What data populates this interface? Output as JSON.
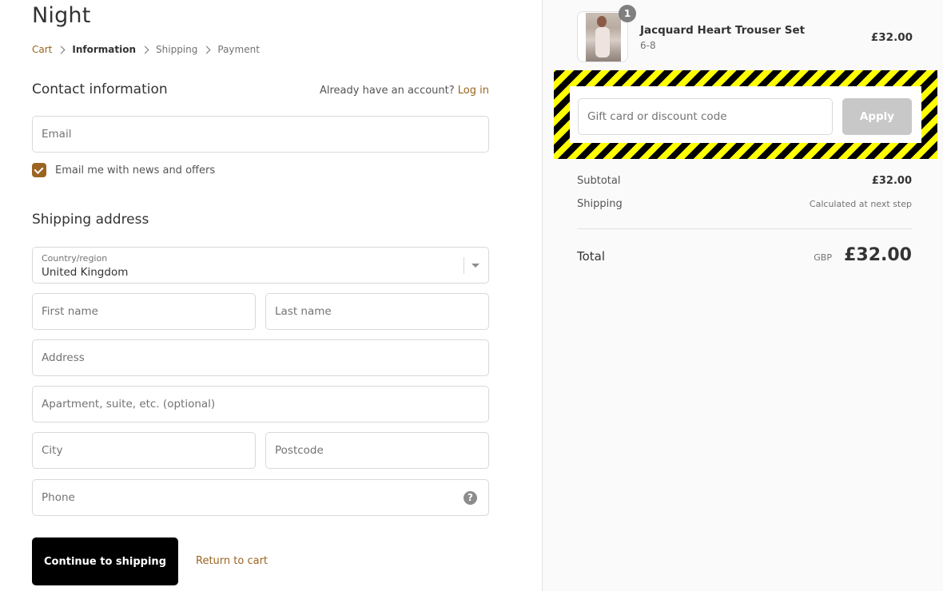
{
  "shop": {
    "title": "Night"
  },
  "breadcrumb": [
    {
      "label": "Cart",
      "state": "link"
    },
    {
      "label": "Information",
      "state": "current"
    },
    {
      "label": "Shipping",
      "state": "upcoming"
    },
    {
      "label": "Payment",
      "state": "upcoming"
    }
  ],
  "contact": {
    "title": "Contact information",
    "login_prompt": "Already have an account?",
    "login_link": "Log in",
    "email_placeholder": "Email",
    "email_value": "",
    "newsletter_label": "Email me with news and offers",
    "newsletter_checked": true
  },
  "shipping": {
    "title": "Shipping address",
    "country_label": "Country/region",
    "country_value": "United Kingdom",
    "first_name_placeholder": "First name",
    "last_name_placeholder": "Last name",
    "address_placeholder": "Address",
    "apartment_placeholder": "Apartment, suite, etc. (optional)",
    "city_placeholder": "City",
    "postcode_placeholder": "Postcode",
    "phone_placeholder": "Phone",
    "phone_help_icon": "?"
  },
  "actions": {
    "continue_label": "Continue to shipping",
    "return_label": "Return to cart"
  },
  "order": {
    "item": {
      "name": "Jacquard Heart Trouser Set",
      "variant": "6-8",
      "price": "£32.00",
      "quantity": "1"
    },
    "discount": {
      "placeholder": "Gift card or discount code",
      "value": "",
      "apply_label": "Apply"
    },
    "subtotal_label": "Subtotal",
    "subtotal_value": "£32.00",
    "shipping_label": "Shipping",
    "shipping_value": "Calculated at next step",
    "total_label": "Total",
    "total_currency": "GBP",
    "total_value": "£32.00"
  },
  "colors": {
    "accent": "#9b6421",
    "primary_button": "#000000",
    "apply_disabled": "#c8c8c8",
    "hazard_yellow": "#ffff00",
    "hazard_black": "#000000"
  }
}
